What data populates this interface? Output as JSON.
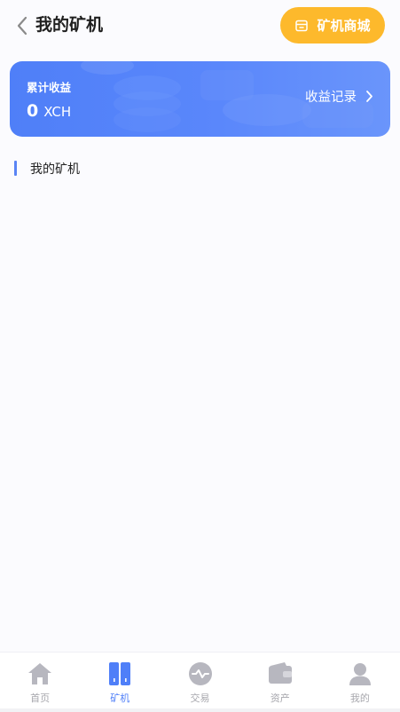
{
  "header": {
    "title": "我的矿机",
    "shop_button_label": "矿机商城"
  },
  "earnings": {
    "label": "累计收益",
    "value": "0",
    "unit": "XCH",
    "record_link": "收益记录"
  },
  "section": {
    "title": "我的矿机"
  },
  "bottom_nav": {
    "items": [
      {
        "label": "首页",
        "icon": "home-icon"
      },
      {
        "label": "矿机",
        "icon": "miner-icon"
      },
      {
        "label": "交易",
        "icon": "exchange-icon"
      },
      {
        "label": "资产",
        "icon": "wallet-icon"
      },
      {
        "label": "我的",
        "icon": "user-icon"
      }
    ],
    "active_index": 1
  },
  "colors": {
    "accent": "#4f7ff8",
    "shop_button": "#fdb92c",
    "nav_inactive": "#b7b7bf"
  }
}
